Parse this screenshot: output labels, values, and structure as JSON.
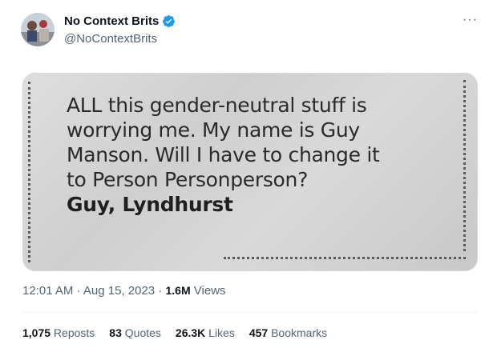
{
  "author": {
    "display_name": "No Context Brits",
    "handle": "@NoContextBrits",
    "verified": true,
    "avatar_icon": "avatar-image",
    "verified_color": "#1d9bf0"
  },
  "menu": {
    "more_label": "···"
  },
  "media": {
    "lines": [
      "ALL this gender-neutral stuff is",
      "worrying me. My name is Guy",
      "Manson. Will I have to change it",
      "to Person Personperson?"
    ],
    "signature": "Guy, Lyndhurst"
  },
  "meta": {
    "time": "12:01 AM",
    "sep1": " · ",
    "date": "Aug 15, 2023",
    "sep2": " · ",
    "views_count": "1.6M",
    "views_label": " Views"
  },
  "stats": {
    "reposts": {
      "count": "1,075",
      "label": " Reposts"
    },
    "quotes": {
      "count": "83",
      "label": " Quotes"
    },
    "likes": {
      "count": "26.3K",
      "label": " Likes"
    },
    "bookmarks": {
      "count": "457",
      "label": " Bookmarks"
    }
  }
}
